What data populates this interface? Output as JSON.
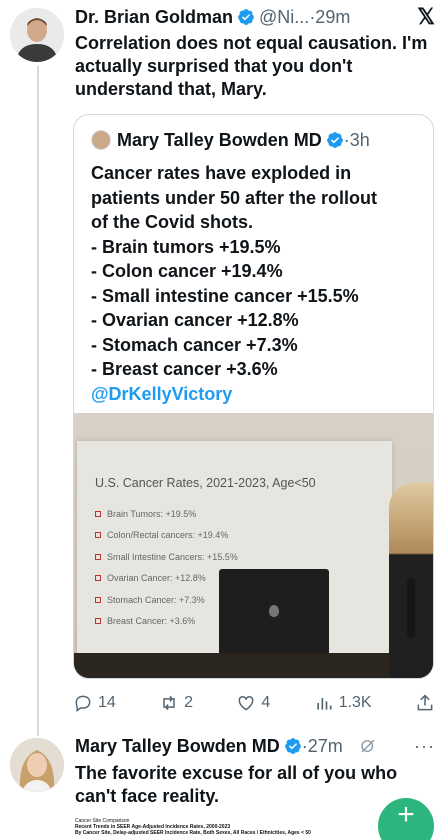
{
  "tweet1": {
    "name": "Dr. Brian Goldman",
    "handle": "@Ni...",
    "time": "·29m",
    "text": "Correlation does not equal causation. I'm actually surprised that you don't understand that, Mary."
  },
  "quote": {
    "name": "Mary Talley Bowden MD",
    "time": "·3h",
    "lines": [
      "Cancer rates have exploded in",
      "patients under 50 after the rollout",
      "of the Covid shots.",
      "- Brain tumors +19.5%",
      "- Colon cancer +19.4%",
      "- Small intestine cancer +15.5%",
      "- Ovarian cancer +12.8%",
      "- Stomach cancer +7.3%",
      "- Breast cancer +3.6%"
    ],
    "mention": "@DrKellyVictory",
    "slide": {
      "title": "U.S. Cancer Rates, 2021-2023, Age<50",
      "items": [
        "Brain Tumors: +19.5%",
        "Colon/Rectal cancers: +19.4%",
        "Small Intestine Cancers: +15.5%",
        "Ovarian Cancer: +12.8%",
        "Stomach Cancer: +7.3%",
        "Breast Cancer: +3.6%"
      ]
    }
  },
  "actions": {
    "replies": "14",
    "reposts": "2",
    "likes": "4",
    "views": "1.3K"
  },
  "tweet2": {
    "name": "Mary Talley Bowden MD",
    "time": "·27m",
    "more": "···",
    "text": "The favorite excuse for all of you who can't face reality."
  },
  "overlay": {
    "line1": "Cancer Site Comparison",
    "line2": "Recent Trends in SEER Age-Adjusted Incidence Rates, 2000-2023",
    "line3": "By Cancer Site, Delay-adjusted SEER Incidence Rate, Both Sexes, All Races / Ethnicities, Ages < 50"
  },
  "fab": {
    "label": "+"
  },
  "colors": {
    "accent": "#1d9bf0",
    "muted": "#536471",
    "fab": "#2cb67d"
  }
}
